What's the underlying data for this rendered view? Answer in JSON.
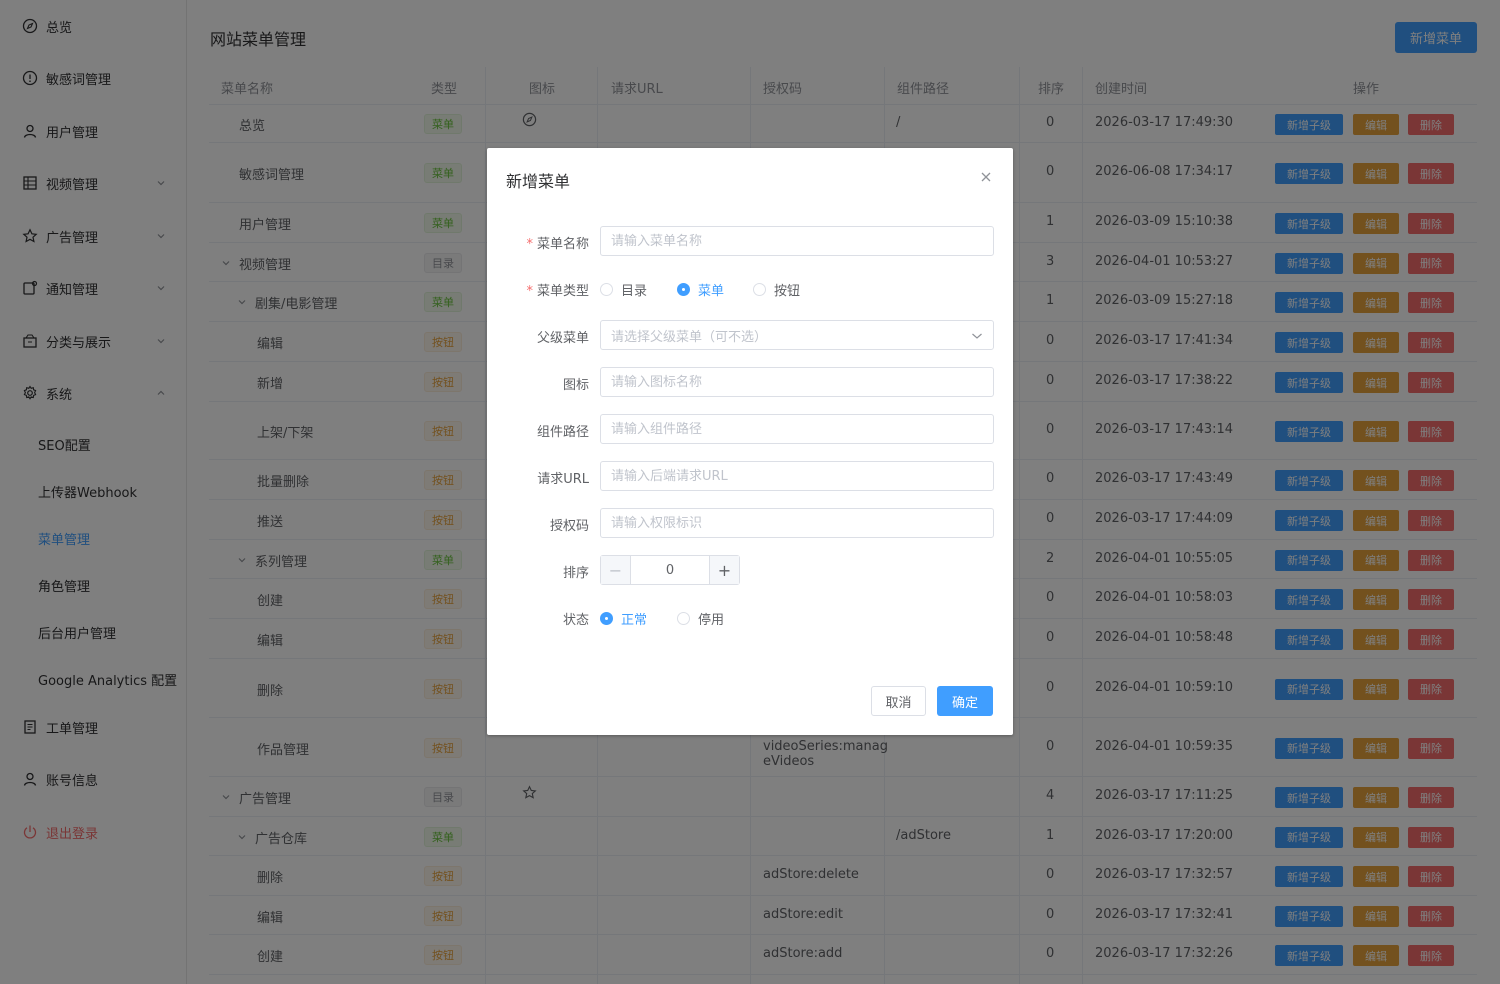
{
  "sidebar": {
    "items": [
      {
        "label": "总览",
        "icon": "dashboard-icon"
      },
      {
        "label": "敏感词管理",
        "icon": "alert-icon"
      },
      {
        "label": "用户管理",
        "icon": "user-icon"
      },
      {
        "label": "视频管理",
        "icon": "grid-icon"
      },
      {
        "label": "广告管理",
        "icon": "star-icon"
      },
      {
        "label": "通知管理",
        "icon": "notification-icon"
      },
      {
        "label": "分类与展示",
        "icon": "box-icon"
      },
      {
        "label": "系统",
        "icon": "gear-icon"
      },
      {
        "label": "工单管理",
        "icon": "document-icon"
      },
      {
        "label": "账号信息",
        "icon": "user-icon"
      },
      {
        "label": "退出登录",
        "icon": "power-icon"
      }
    ],
    "system_children": [
      "SEO配置",
      "上传器Webhook",
      "菜单管理",
      "角色管理",
      "后台用户管理",
      "Google Analytics 配置"
    ]
  },
  "header": {
    "title": "网站菜单管理",
    "add_button": "新增菜单"
  },
  "table": {
    "columns": [
      "菜单名称",
      "类型",
      "图标",
      "请求URL",
      "授权码",
      "组件路径",
      "排序",
      "创建时间",
      "操作"
    ],
    "actions": {
      "add_child": "新增子级",
      "edit": "编辑",
      "delete": "删除"
    },
    "rows": [
      {
        "name": "总览",
        "type": "菜单",
        "path": "/",
        "order": "0",
        "time": "2026-03-17 17:49:30"
      },
      {
        "name": "敏感词管理",
        "type": "菜单",
        "order": "0",
        "time": "2026-06-08 17:34:17"
      },
      {
        "name": "用户管理",
        "type": "菜单",
        "order": "1",
        "time": "2026-03-09 15:10:38"
      },
      {
        "name": "视频管理",
        "type": "目录",
        "order": "3",
        "time": "2026-04-01 10:53:27"
      },
      {
        "name": "剧集/电影管理",
        "type": "菜单",
        "order": "1",
        "time": "2026-03-09 15:27:18"
      },
      {
        "name": "编辑",
        "type": "按钮",
        "order": "0",
        "time": "2026-03-17 17:41:34"
      },
      {
        "name": "新增",
        "type": "按钮",
        "order": "0",
        "time": "2026-03-17 17:38:22"
      },
      {
        "name": "上架/下架",
        "type": "按钮",
        "order": "0",
        "time": "2026-03-17 17:43:14"
      },
      {
        "name": "批量删除",
        "type": "按钮",
        "order": "0",
        "time": "2026-03-17 17:43:49"
      },
      {
        "name": "推送",
        "type": "按钮",
        "order": "0",
        "time": "2026-03-17 17:44:09"
      },
      {
        "name": "系列管理",
        "type": "菜单",
        "order": "2",
        "time": "2026-04-01 10:55:05"
      },
      {
        "name": "创建",
        "type": "按钮",
        "order": "0",
        "time": "2026-04-01 10:58:03"
      },
      {
        "name": "编辑",
        "type": "按钮",
        "order": "0",
        "time": "2026-04-01 10:58:48"
      },
      {
        "name": "删除",
        "type": "按钮",
        "order": "0",
        "time": "2026-04-01 10:59:10"
      },
      {
        "name": "作品管理",
        "type": "按钮",
        "perm": "videoSeries:manageVideos",
        "order": "0",
        "time": "2026-04-01 10:59:35"
      },
      {
        "name": "广告管理",
        "type": "目录",
        "order": "4",
        "time": "2026-03-17 17:11:25"
      },
      {
        "name": "广告仓库",
        "type": "菜单",
        "path": "/adStore",
        "order": "1",
        "time": "2026-03-17 17:20:00"
      },
      {
        "name": "删除",
        "type": "按钮",
        "perm": "adStore:delete",
        "order": "0",
        "time": "2026-03-17 17:32:57"
      },
      {
        "name": "编辑",
        "type": "按钮",
        "perm": "adStore:edit",
        "order": "0",
        "time": "2026-03-17 17:32:41"
      },
      {
        "name": "创建",
        "type": "按钮",
        "perm": "adStore:add",
        "order": "0",
        "time": "2026-03-17 17:32:26"
      }
    ]
  },
  "dialog": {
    "title": "新增菜单",
    "fields": {
      "name": {
        "label": "菜单名称",
        "placeholder": "请输入菜单名称"
      },
      "type": {
        "label": "菜单类型",
        "options": [
          "目录",
          "菜单",
          "按钮"
        ],
        "selected": "菜单"
      },
      "parent": {
        "label": "父级菜单",
        "placeholder": "请选择父级菜单（可不选）"
      },
      "icon": {
        "label": "图标",
        "placeholder": "请输入图标名称"
      },
      "component": {
        "label": "组件路径",
        "placeholder": "请输入组件路径"
      },
      "url": {
        "label": "请求URL",
        "placeholder": "请输入后端请求URL"
      },
      "perm": {
        "label": "授权码",
        "placeholder": "请输入权限标识"
      },
      "order": {
        "label": "排序",
        "value": "0"
      },
      "status": {
        "label": "状态",
        "options": [
          "正常",
          "停用"
        ],
        "selected": "正常"
      }
    },
    "cancel": "取消",
    "confirm": "确定"
  },
  "colors": {
    "primary": "#409eff",
    "warning": "#e6a23c",
    "danger": "#f56c6c",
    "success": "#67c23a"
  }
}
